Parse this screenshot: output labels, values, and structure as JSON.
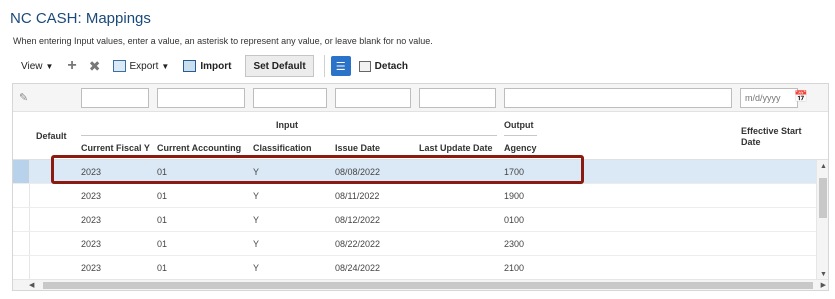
{
  "page": {
    "title": "NC CASH: Mappings",
    "instructions": "When entering Input values, enter a value, an asterisk to represent any value, or leave blank for no value."
  },
  "toolbar": {
    "view_label": "View",
    "export_label": "Export",
    "import_label": "Import",
    "set_default_label": "Set Default",
    "detach_label": "Detach"
  },
  "filter": {
    "date_placeholder": "m/d/yyyy"
  },
  "table": {
    "group_input": "Input",
    "group_output": "Output",
    "columns": {
      "default": "Default",
      "current_fiscal": "Current Fiscal Y",
      "current_accounting": "Current Accounting",
      "classification": "Classification",
      "issue_date": "Issue Date",
      "last_update_date": "Last Update Date",
      "agency": "Agency",
      "effective_start": "Effective Start",
      "effective_start_2": "Date"
    },
    "rows": [
      {
        "fiscal": "2023",
        "accounting": "01",
        "classification": "Y",
        "issue_date": "08/08/2022",
        "last_update": "",
        "agency": "1700",
        "effective_start": ""
      },
      {
        "fiscal": "2023",
        "accounting": "01",
        "classification": "Y",
        "issue_date": "08/11/2022",
        "last_update": "",
        "agency": "1900",
        "effective_start": ""
      },
      {
        "fiscal": "2023",
        "accounting": "01",
        "classification": "Y",
        "issue_date": "08/12/2022",
        "last_update": "",
        "agency": "0100",
        "effective_start": ""
      },
      {
        "fiscal": "2023",
        "accounting": "01",
        "classification": "Y",
        "issue_date": "08/22/2022",
        "last_update": "",
        "agency": "2300",
        "effective_start": ""
      },
      {
        "fiscal": "2023",
        "accounting": "01",
        "classification": "Y",
        "issue_date": "08/24/2022",
        "last_update": "",
        "agency": "2100",
        "effective_start": ""
      }
    ],
    "selected_row": 0
  },
  "colors": {
    "title": "#1a4a7a",
    "selected_row": "#dbe9f7",
    "highlight_border": "#8b1a10",
    "qbe_button": "#2a73c8"
  }
}
